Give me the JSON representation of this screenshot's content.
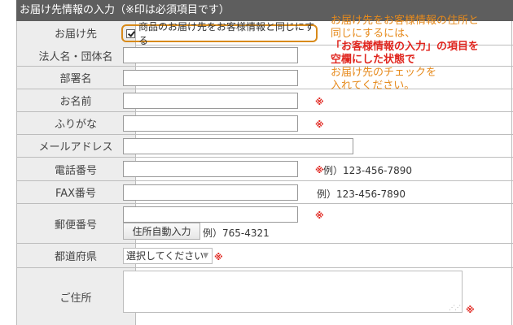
{
  "header": {
    "title": "お届け先情報の入力（※印は必須項目です）"
  },
  "required_mark": "※",
  "rows": {
    "delivery": {
      "label": "お届け先",
      "checkbox_label": "商品のお届け先をお客様情報と同じにする",
      "checked": true
    },
    "company": {
      "label": "法人名・団体名",
      "value": ""
    },
    "department": {
      "label": "部署名",
      "value": ""
    },
    "name": {
      "label": "お名前",
      "value": ""
    },
    "furigana": {
      "label": "ふりがな",
      "value": ""
    },
    "email": {
      "label": "メールアドレス",
      "value": ""
    },
    "phone": {
      "label": "電話番号",
      "value": "",
      "example": "例）123-456-7890"
    },
    "fax": {
      "label": "FAX番号",
      "value": "",
      "example": "例）123-456-7890"
    },
    "postal": {
      "label": "郵便番号",
      "value": "",
      "button_label": "住所自動入力",
      "example": "例）765-4321"
    },
    "prefecture": {
      "label": "都道府県",
      "selected": "選択してください"
    },
    "address": {
      "label": "ご住所",
      "value": ""
    }
  },
  "annotation": {
    "line1": "お届け先をお客様情報の住所と",
    "line2": "同じにするには、",
    "line3": "「お客様情報の入力」の項目を",
    "line4": "空欄にした状態で",
    "line5": "お届け先のチェックを",
    "line6": "入れてください。"
  },
  "colors": {
    "header_bg": "#5e5e5e",
    "label_bg": "#ededed",
    "required": "#e0261f",
    "annotation": "#e68a1c",
    "highlight_border": "#d88a1a"
  }
}
